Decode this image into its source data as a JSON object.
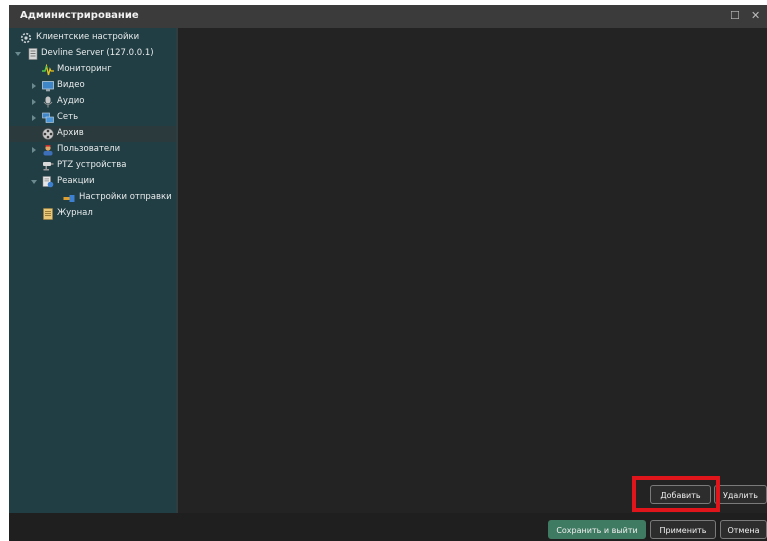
{
  "window": {
    "title": "Администрирование"
  },
  "window_controls": {
    "maximize": "☐",
    "close": "✕"
  },
  "sidebar": {
    "items": [
      {
        "label": "Клиентские настройки",
        "icon": "gear-icon"
      },
      {
        "label": "Devline Server (127.0.0.1)",
        "icon": "server-icon"
      },
      {
        "label": "Мониторинг",
        "icon": "monitoring-icon"
      },
      {
        "label": "Видео",
        "icon": "monitor-icon"
      },
      {
        "label": "Аудио",
        "icon": "microphone-icon"
      },
      {
        "label": "Сеть",
        "icon": "network-icon"
      },
      {
        "label": "Архив",
        "icon": "film-reel-icon"
      },
      {
        "label": "Пользователи",
        "icon": "users-icon"
      },
      {
        "label": "PTZ устройства",
        "icon": "ptz-camera-icon"
      },
      {
        "label": "Реакции",
        "icon": "reactions-icon"
      },
      {
        "label": "Настройки отправки",
        "icon": "send-settings-icon"
      },
      {
        "label": "Журнал",
        "icon": "journal-icon"
      }
    ]
  },
  "content": {
    "add_label": "Добавить",
    "delete_label": "Удалить"
  },
  "footer": {
    "save_exit_label": "Сохранить и выйти",
    "apply_label": "Применить",
    "cancel_label": "Отмена"
  },
  "colors": {
    "accent": "#3f7a62",
    "highlight": "#e0151b",
    "sidebar": "#223e45"
  }
}
